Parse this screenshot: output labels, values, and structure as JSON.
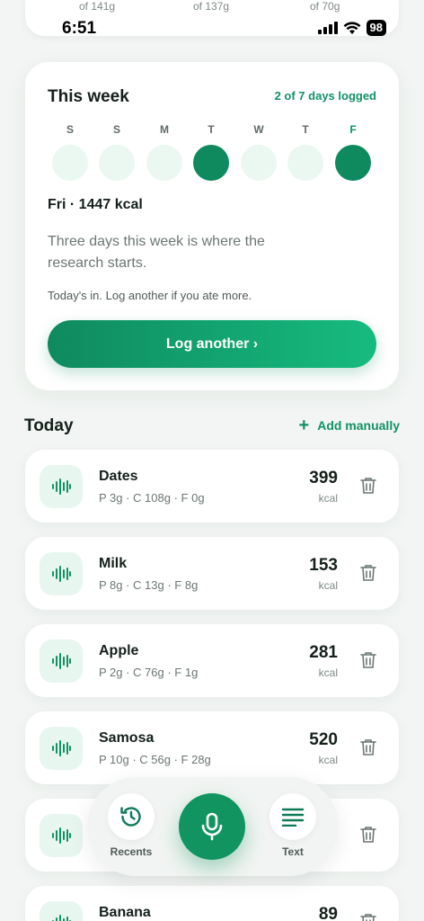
{
  "top_macros": {
    "protein": "of 141g",
    "carbs": "of 137g",
    "fat": "of 70g"
  },
  "status_bar": {
    "time": "6:51",
    "battery": "98"
  },
  "week": {
    "title": "This week",
    "logged_summary": "2 of 7 days logged",
    "days": [
      {
        "letter": "S",
        "logged": false
      },
      {
        "letter": "S",
        "logged": false
      },
      {
        "letter": "M",
        "logged": false
      },
      {
        "letter": "T",
        "logged": true
      },
      {
        "letter": "W",
        "logged": false
      },
      {
        "letter": "T",
        "logged": false
      },
      {
        "letter": "F",
        "logged": true
      }
    ],
    "selected_summary": "Fri · 1447 kcal",
    "message": "Three days this week is where the research starts.",
    "note": "Today's in. Log another if you ate more.",
    "log_button": "Log another ›"
  },
  "today": {
    "title": "Today",
    "add_manually": "Add manually",
    "items": [
      {
        "name": "Dates",
        "macros": "P 3g · C 108g · F 0g",
        "kcal": "399",
        "unit": "kcal"
      },
      {
        "name": "Milk",
        "macros": "P 8g · C 13g · F 8g",
        "kcal": "153",
        "unit": "kcal"
      },
      {
        "name": "Apple",
        "macros": "P 2g · C 76g · F 1g",
        "kcal": "281",
        "unit": "kcal"
      },
      {
        "name": "Samosa",
        "macros": "P 10g · C 56g · F 28g",
        "kcal": "520",
        "unit": "kcal"
      },
      {
        "name": "",
        "macros": "",
        "kcal": "",
        "unit": ""
      },
      {
        "name": "Banana",
        "macros": "",
        "kcal": "89",
        "unit": ""
      }
    ]
  },
  "dock": {
    "recents_label": "Recents",
    "text_label": "Text"
  },
  "colors": {
    "accent": "#0f8a5f",
    "accent_light": "#16bb80",
    "dot_empty": "#eaf8f1"
  }
}
